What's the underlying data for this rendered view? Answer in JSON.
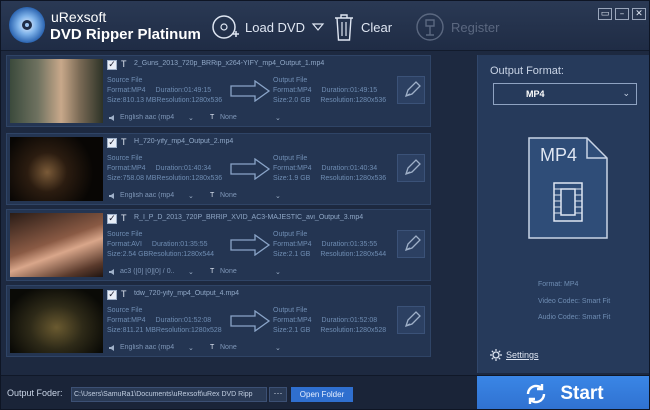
{
  "app": {
    "brand_line1": "uRexsoft",
    "brand_line2": "DVD Ripper Platinum"
  },
  "toolbar": {
    "load_label": "Load DVD",
    "clear_label": "Clear",
    "register_label": "Register"
  },
  "labels": {
    "source": "Source File",
    "output": "Output File",
    "format_prefix": "Format:",
    "duration_prefix": "Duration:",
    "size_prefix": "Size:",
    "resolution_prefix": "Resolution:",
    "t_glyph": "T"
  },
  "items": [
    {
      "filename": "2_Guns_2013_720p_BRRip_x264-YIFY_mp4_Output_1.mp4",
      "src_format": "MP4",
      "src_duration": "01:49:15",
      "src_size": "810.13 MB",
      "src_resolution": "1280x536",
      "out_format": "MP4",
      "out_duration": "01:49:15",
      "out_size": "2.0 GB",
      "out_resolution": "1280x536",
      "audio": "English aac (mp4....",
      "subtitle": "None"
    },
    {
      "filename": "H_720-yify_mp4_Output_2.mp4",
      "src_format": "MP4",
      "src_duration": "01:40:34",
      "src_size": "758.08 MB",
      "src_resolution": "1280x536",
      "out_format": "MP4",
      "out_duration": "01:40:34",
      "out_size": "1.9 GB",
      "out_resolution": "1280x536",
      "audio": "English aac (mp4 ...",
      "subtitle": "None"
    },
    {
      "filename": "R_I_P_D_2013_720P_BRRIP_XVID_AC3-MAJESTIC_avi_Output_3.mp4",
      "src_format": "AVI",
      "src_duration": "01:35:55",
      "src_size": "2.54 GB",
      "src_resolution": "1280x544",
      "out_format": "MP4",
      "out_duration": "01:35:55",
      "out_size": "2.1 GB",
      "out_resolution": "1280x544",
      "audio": "ac3 ([0] [0][0] / 0....",
      "subtitle": "None"
    },
    {
      "filename": "tdw_720-yify_mp4_Output_4.mp4",
      "src_format": "MP4",
      "src_duration": "01:52:08",
      "src_size": "811.21 MB",
      "src_resolution": "1280x528",
      "out_format": "MP4",
      "out_duration": "01:52:08",
      "out_size": "2.1 GB",
      "out_resolution": "1280x528",
      "audio": "English aac (mp4....",
      "subtitle": "None"
    }
  ],
  "right_panel": {
    "output_format_label": "Output Format:",
    "selected_format": "MP4",
    "icon_label": "MP4",
    "format_info": "Format: MP4",
    "video_codec": "Video Codec: Smart Fit",
    "audio_codec": "Audio Codec: Smart Fit",
    "settings_label": "Settings"
  },
  "bottom": {
    "output_folder_label": "Output Foder:",
    "path": "C:\\Users\\SamuRa1\\Documents\\uRexsoft\\uRex DVD Ripp",
    "browse_label": "···",
    "open_folder_label": "Open Folder",
    "start_label": "Start"
  },
  "colors": {
    "accent": "#2f70cf",
    "panel": "#263a5b",
    "background": "#1d2940"
  }
}
